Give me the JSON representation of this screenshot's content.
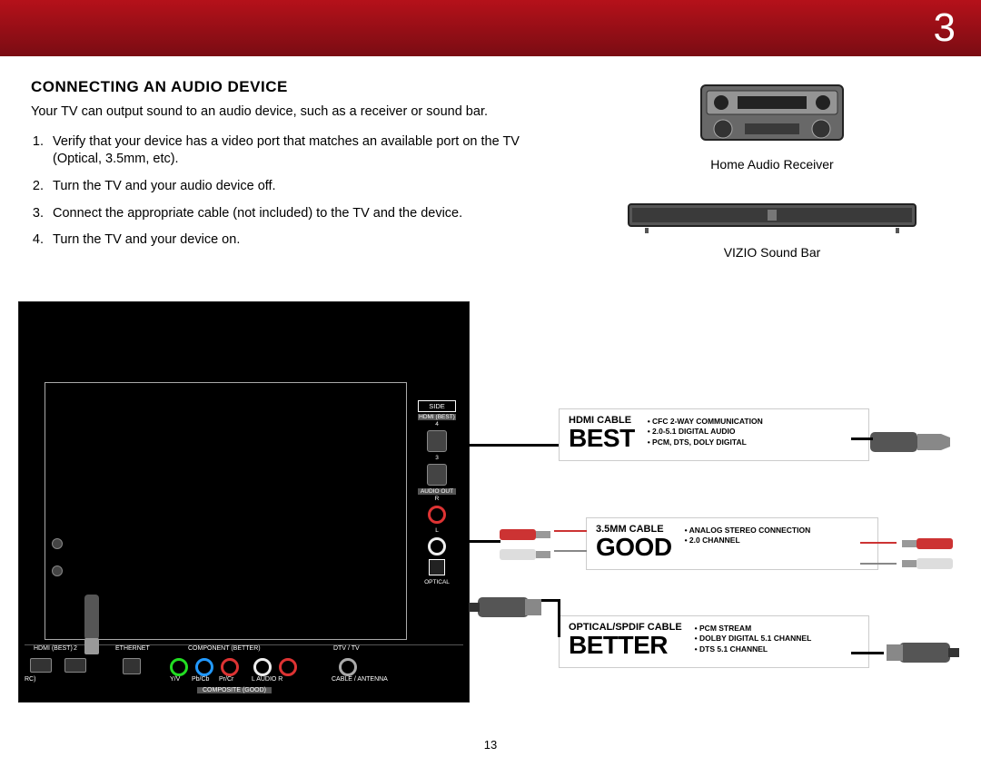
{
  "header": {
    "chapter_number": "3"
  },
  "section": {
    "title": "CONNECTING AN AUDIO DEVICE",
    "intro": "Your TV can output sound to an audio device, such as a receiver or sound bar.",
    "steps": [
      "Verify that your device has a video port that matches an available port on the TV (Optical, 3.5mm, etc).",
      "Turn the TV and your audio device off.",
      "Connect the appropriate cable (not included) to the TV and the device.",
      "Turn the TV and your device on."
    ]
  },
  "devices": {
    "receiver_label": "Home Audio Receiver",
    "soundbar_label": "VIZIO Sound Bar"
  },
  "tv_ports": {
    "side_title": "SIDE",
    "hdmi_best": "HDMI (BEST)",
    "port4": "4",
    "port3": "3",
    "audio_out": "AUDIO OUT",
    "r": "R",
    "l": "L",
    "optical": "OPTICAL",
    "bottom_hdmi": "HDMI (BEST)",
    "bottom_arc": "RC)",
    "bottom_2": "2",
    "bottom_ethernet": "ETHERNET",
    "bottom_component": "COMPONENT (BETTER)",
    "bottom_yv": "Y/V",
    "bottom_pb": "Pb/Cb",
    "bottom_pr": "Pr/Cr",
    "bottom_laudio": "L  AUDIO  R",
    "bottom_composite": "COMPOSITE (GOOD)",
    "bottom_dtv": "DTV / TV",
    "bottom_cable": "CABLE / ANTENNA"
  },
  "callouts": {
    "hdmi": {
      "title": "HDMI CABLE",
      "rating": "BEST",
      "features": [
        "CFC 2-WAY COMMUNICATION",
        "2.0-5.1 DIGITAL AUDIO",
        "PCM, DTS, DOLY DIGITAL"
      ]
    },
    "aux": {
      "title": "3.5MM CABLE",
      "rating": "GOOD",
      "features": [
        "ANALOG STEREO CONNECTION",
        "2.0 CHANNEL"
      ]
    },
    "optical": {
      "title": "OPTICAL/SPDIF CABLE",
      "rating": "BETTER",
      "features": [
        "PCM STREAM",
        "DOLBY DIGITAL 5.1 CHANNEL",
        "DTS 5.1 CHANNEL"
      ]
    }
  },
  "page_number": "13"
}
